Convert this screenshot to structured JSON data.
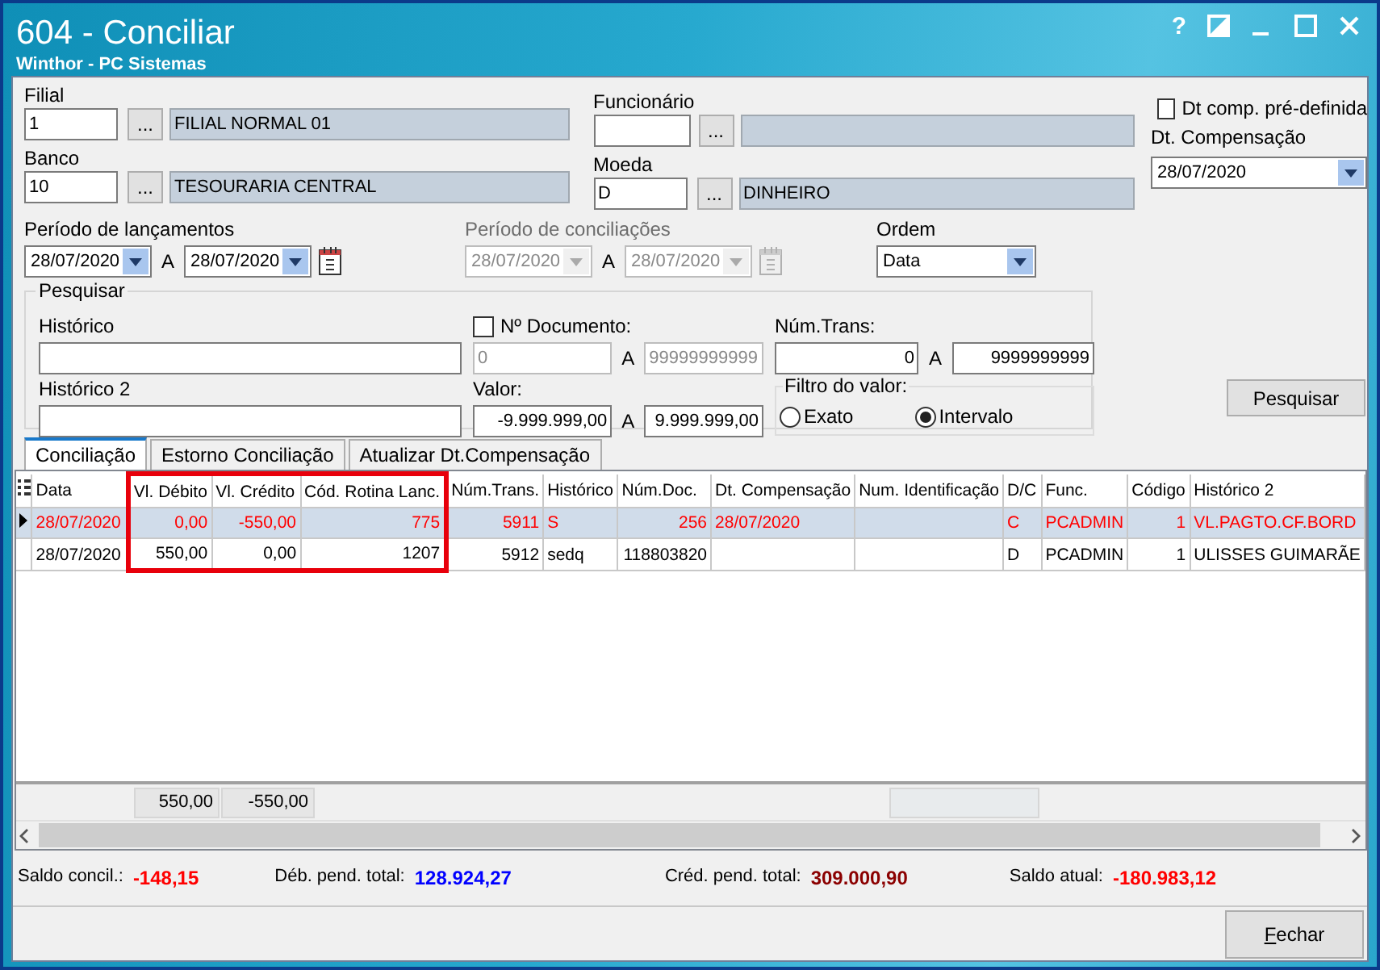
{
  "window": {
    "title": "604 - Conciliar",
    "subtitle": "Winthor - PC Sistemas",
    "help": "?"
  },
  "filial": {
    "label": "Filial",
    "code": "1",
    "button": "...",
    "name": "FILIAL NORMAL 01"
  },
  "banco": {
    "label": "Banco",
    "code": "10",
    "button": "...",
    "name": "TESOURARIA CENTRAL"
  },
  "funcionario": {
    "label": "Funcionário",
    "button": "..."
  },
  "moeda": {
    "label": "Moeda",
    "code": "D",
    "button": "...",
    "name": "DINHEIRO"
  },
  "dt_comp_predefinida": {
    "label": "Dt comp. pré-definida",
    "checked": false
  },
  "dt_compensacao": {
    "label": "Dt. Compensação",
    "value": "28/07/2020"
  },
  "periodo_lancamentos": {
    "label": "Período de lançamentos",
    "from": "28/07/2020",
    "separator": "A",
    "to": "28/07/2020",
    "disabled": false
  },
  "periodo_conciliacoes": {
    "label": "Período de conciliações",
    "from": "28/07/2020",
    "separator": "A",
    "to": "28/07/2020",
    "disabled": true
  },
  "ordem": {
    "label": "Ordem",
    "value": "Data"
  },
  "search": {
    "title": "Pesquisar",
    "historico": {
      "label": "Histórico"
    },
    "nr_documento": {
      "label": "Nº Documento:",
      "checked": false,
      "from": "0",
      "separator": "A",
      "to": "99999999999"
    },
    "num_trans": {
      "label": "Núm.Trans:",
      "from": "0",
      "separator": "A",
      "to": "9999999999"
    },
    "historico_2": {
      "label": "Histórico 2"
    },
    "valor": {
      "label": "Valor:",
      "from": "-9.999.999,00",
      "separator": "A",
      "to": "9.999.999,00"
    },
    "filtro_valor": {
      "label": "Filtro do valor:",
      "options": [
        {
          "label": "Exato",
          "selected": false
        },
        {
          "label": "Intervalo",
          "selected": true
        }
      ]
    },
    "button": "Pesquisar"
  },
  "tabs": [
    {
      "label": "Conciliação",
      "selected": true
    },
    {
      "label": "Estorno Conciliação",
      "selected": false
    },
    {
      "label": "Atualizar Dt.Compensação",
      "selected": false
    }
  ],
  "table": {
    "columns": [
      {
        "label": "Data",
        "highlighted": false
      },
      {
        "label": "Vl. Débito",
        "highlighted": true
      },
      {
        "label": "Vl. Crédito",
        "highlighted": true
      },
      {
        "label": "Cód. Rotina Lanc.",
        "highlighted": true
      },
      {
        "label": "Núm.Trans.",
        "highlighted": false
      },
      {
        "label": "Histórico",
        "highlighted": false
      },
      {
        "label": "Núm.Doc.",
        "highlighted": false
      },
      {
        "label": "Dt. Compensação",
        "highlighted": false
      },
      {
        "label": "Num. Identificação",
        "highlighted": false
      },
      {
        "label": "D/C",
        "highlighted": false
      },
      {
        "label": "Func.",
        "highlighted": false
      },
      {
        "label": "Código",
        "highlighted": false
      },
      {
        "label": "Histórico 2",
        "highlighted": false
      }
    ],
    "rows": [
      {
        "selected": true,
        "color": "#ff0000",
        "cells": [
          "28/07/2020",
          "0,00",
          "-550,00",
          "775",
          "5911",
          "S",
          "256",
          "28/07/2020",
          null,
          "C",
          "PCADMIN",
          "1",
          "VL.PAGTO.CF.BORD"
        ]
      },
      {
        "selected": false,
        "color": "#000000",
        "cells": [
          "28/07/2020",
          "550,00",
          "0,00",
          "1207",
          "5912",
          "sedq",
          "118803820",
          null,
          null,
          "D",
          "PCADMIN",
          "1",
          "ULISSES GUIMARÃE"
        ]
      }
    ],
    "footer_debito": "550,00",
    "footer_credito": "-550,00"
  },
  "status_bar": [
    {
      "label": "Saldo concil.:",
      "value": "-148,15",
      "color": "#ff0000"
    },
    {
      "label": "Déb. pend. total:",
      "value": "128.924,27",
      "color": "#0000ff"
    },
    {
      "label": "Créd. pend. total:",
      "value": "309.000,90",
      "color": "#8b0000"
    },
    {
      "label": "Saldo atual:",
      "value": "-180.983,12",
      "color": "#ff0000"
    }
  ],
  "close_button": "Fechar"
}
